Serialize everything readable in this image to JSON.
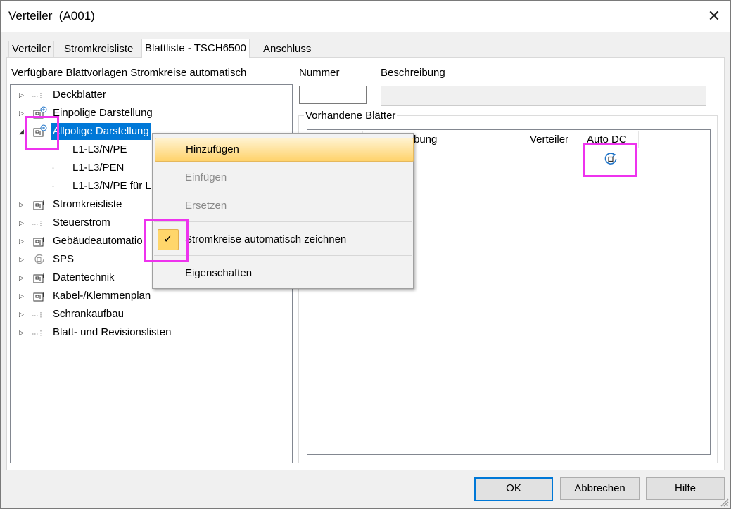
{
  "window": {
    "title": "Verteiler  (A001)"
  },
  "tabs": [
    {
      "label": "Verteiler"
    },
    {
      "label": "Stromkreisliste"
    },
    {
      "label": "Blattliste - TSCH6500"
    },
    {
      "label": "Anschluss"
    }
  ],
  "left": {
    "heading": "Verfügbare Blattvorlagen Stromkreise automatisch",
    "tree": [
      {
        "label": "Deckblätter",
        "icon": "dotted-branch-icon"
      },
      {
        "label": "Einpolige Darstellung",
        "icon": "sheet-group-icon"
      },
      {
        "label": "Allpolige Darstellung",
        "icon": "sheet-group-icon",
        "selected": true
      },
      {
        "label": "L1-L3/N/PE"
      },
      {
        "label": "L1-L3/PEN"
      },
      {
        "label": "L1-L3/N/PE für L"
      },
      {
        "label": "Stromkreisliste",
        "icon": "sheet-group-icon"
      },
      {
        "label": "Steuerstrom",
        "icon": "dotted-branch-icon"
      },
      {
        "label": "Gebäudeautomatio",
        "icon": "sheet-group-icon"
      },
      {
        "label": "SPS",
        "icon": "auto-dc-icon"
      },
      {
        "label": "Datentechnik",
        "icon": "sheet-group-icon"
      },
      {
        "label": "Kabel-/Klemmenplan",
        "icon": "sheet-group-icon"
      },
      {
        "label": "Schrankaufbau",
        "icon": "dotted-branch-icon"
      },
      {
        "label": "Blatt- und Revisionslisten",
        "icon": "dotted-branch-icon"
      }
    ]
  },
  "right": {
    "nummer_label": "Nummer",
    "nummer_value": "",
    "beschreibung_label": "Beschreibung",
    "beschreibung_value": "",
    "group_label": "Vorhandene Blätter",
    "columns": {
      "beschreibung_partial": "bung",
      "verteiler": "Verteiler",
      "auto_dc": "Auto DC"
    }
  },
  "context_menu": {
    "items": [
      {
        "label": "Hinzufügen",
        "state": "highlighted"
      },
      {
        "label": "Einfügen",
        "state": "disabled"
      },
      {
        "label": "Ersetzen",
        "state": "disabled"
      },
      {
        "label": "Stromkreise automatisch zeichnen",
        "checked": true,
        "check_glyph": "✓"
      },
      {
        "label": "Eigenschaften"
      }
    ]
  },
  "buttons": {
    "ok": "OK",
    "cancel": "Abbrechen",
    "help": "Hilfe"
  },
  "colors": {
    "selection": "#0078d7",
    "highlight_box": "#ee33ee",
    "menu_highlight": "#ffd36b",
    "icon_blue": "#1e73c8"
  }
}
